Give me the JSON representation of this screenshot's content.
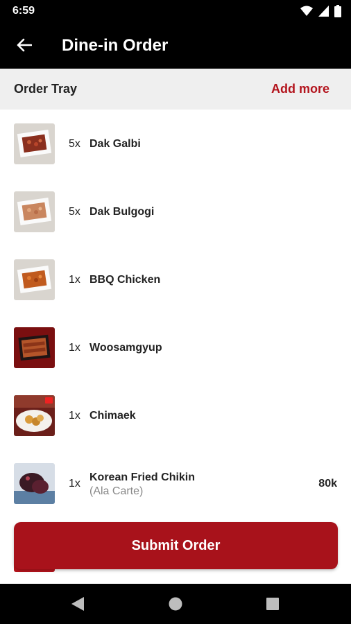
{
  "status_bar": {
    "time": "6:59",
    "icons": [
      "wifi-icon",
      "signal-icon",
      "battery-icon"
    ]
  },
  "app_bar": {
    "title": "Dine-in Order",
    "back_icon": "arrow-left-icon"
  },
  "tray": {
    "title": "Order Tray",
    "add_more_label": "Add more"
  },
  "items": [
    {
      "qty": "5x",
      "name": "Dak Galbi",
      "thumb_icon": "food-tray-icon"
    },
    {
      "qty": "5x",
      "name": "Dak Bulgogi",
      "thumb_icon": "food-tray-icon"
    },
    {
      "qty": "1x",
      "name": "BBQ Chicken",
      "thumb_icon": "food-tray-icon"
    },
    {
      "qty": "1x",
      "name": "Woosamgyup",
      "thumb_icon": "food-box-icon"
    },
    {
      "qty": "1x",
      "name": "Chimaek",
      "thumb_icon": "food-plate-icon"
    },
    {
      "qty": "1x",
      "name": "Korean Fried Chikin",
      "subtitle": "(Ala Carte)",
      "price": "80k",
      "thumb_icon": "food-photo-icon"
    }
  ],
  "submit": {
    "label": "Submit Order"
  },
  "colors": {
    "accent": "#a8121b",
    "add_more": "#b3141d",
    "header_bg": "#000000",
    "tray_bg": "#efefef"
  },
  "nav_bar": {
    "icons": [
      "back-triangle-icon",
      "home-circle-icon",
      "recents-square-icon"
    ]
  }
}
